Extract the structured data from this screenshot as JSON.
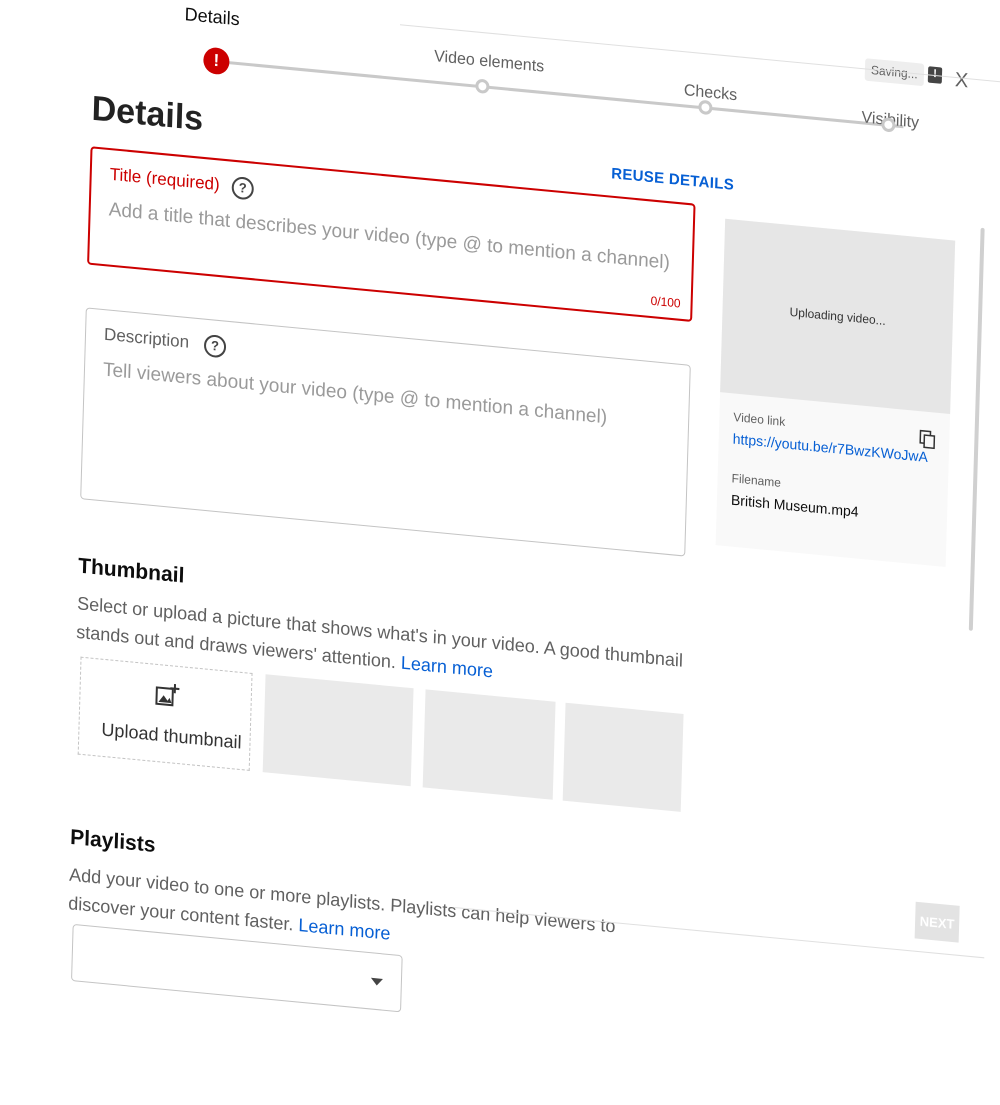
{
  "stepper": {
    "steps": [
      {
        "label": "Details"
      },
      {
        "label": "Video elements"
      },
      {
        "label": "Checks"
      },
      {
        "label": "Visibility"
      }
    ],
    "error_mark": "!"
  },
  "header": {
    "saving_label": "Saving...",
    "close_label": "X",
    "feedback_mark": "!"
  },
  "main": {
    "page_title": "Details",
    "reuse_label": "REUSE DETAILS",
    "title_field": {
      "label": "Title (required)",
      "placeholder": "Add a title that describes your video (type @ to mention a channel)",
      "counter": "0/100",
      "help": "?"
    },
    "description_field": {
      "label": "Description",
      "placeholder": "Tell viewers about your video (type @ to mention a channel)",
      "help": "?"
    },
    "thumbnail": {
      "title": "Thumbnail",
      "text": "Select or upload a picture that shows what's in your video. A good thumbnail stands out and draws viewers' attention.",
      "learn_more": "Learn more",
      "upload_label": "Upload thumbnail"
    },
    "playlists": {
      "title": "Playlists",
      "text": "Add your video to one or more playlists. Playlists can help viewers to discover your content faster.",
      "learn_more": "Learn more"
    }
  },
  "side": {
    "preview_status": "Uploading video...",
    "video_link_label": "Video link",
    "video_link": "https://youtu.be/r7BwzKWoJwA",
    "filename_label": "Filename",
    "filename": "British Museum.mp4"
  },
  "footer": {
    "next_label": "NEXT"
  },
  "colors": {
    "error": "#cc0000",
    "link": "#065fd4",
    "accent_grey": "#c9c9c9"
  }
}
